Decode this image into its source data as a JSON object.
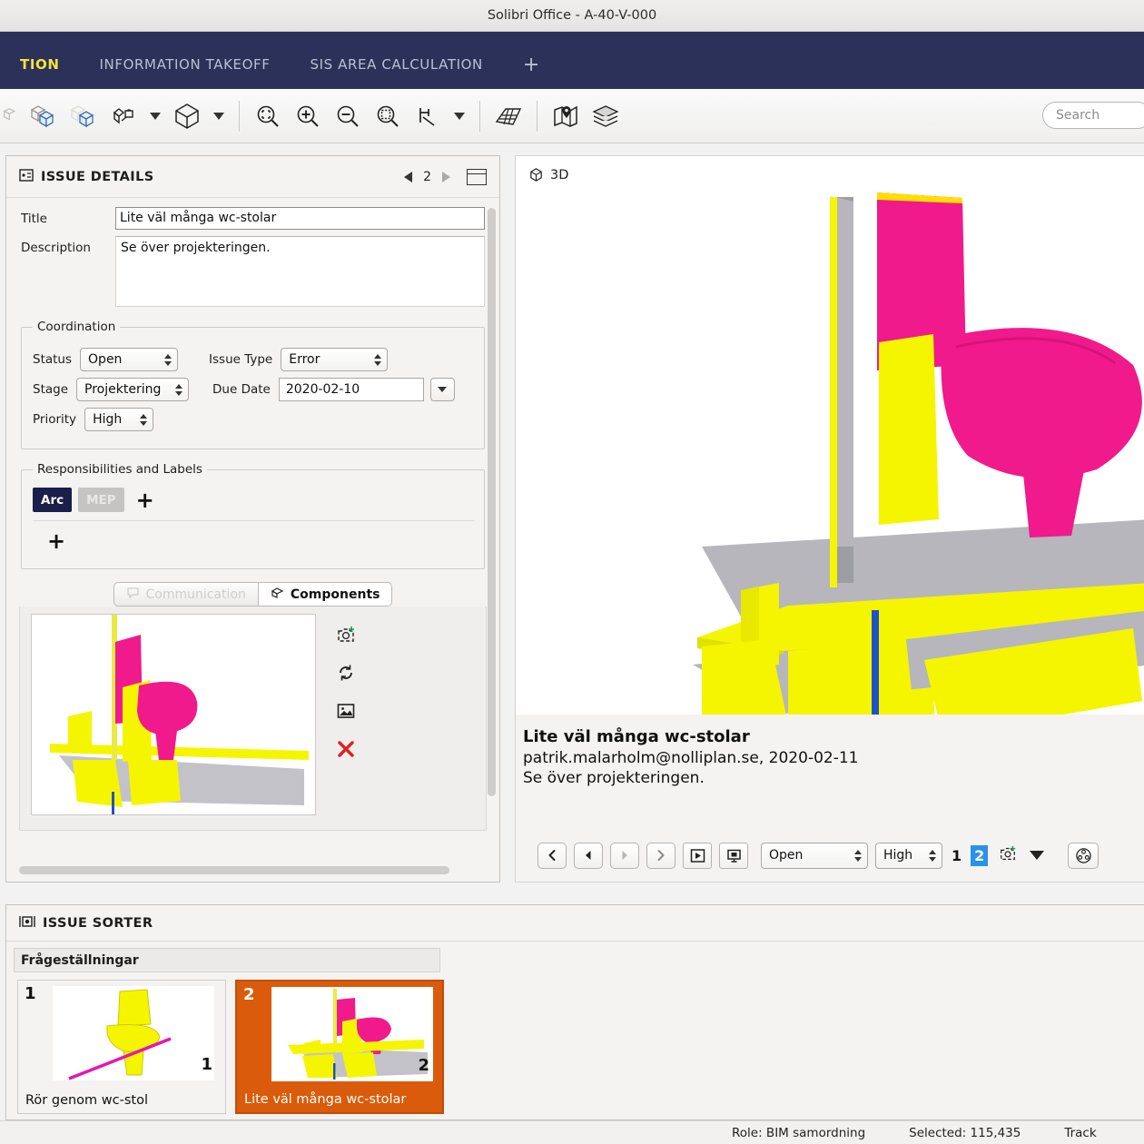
{
  "window": {
    "title": "Solibri Office - A-40-V-000"
  },
  "tabs": {
    "items": [
      {
        "label": "TION",
        "active": true
      },
      {
        "label": "INFORMATION TAKEOFF",
        "active": false
      },
      {
        "label": "SIS AREA CALCULATION",
        "active": false
      }
    ],
    "add_label": "+"
  },
  "toolbar": {
    "icons": [
      "model-tree-icon",
      "selection-basket-icon",
      "component-lock-icon",
      "view-cube-icon",
      "zoom-fit-icon",
      "zoom-in-icon",
      "zoom-out-icon",
      "zoom-area-icon",
      "section-icon",
      "grid-icon",
      "map-icon",
      "layers-icon"
    ],
    "search_placeholder": "Search",
    "search_value": ""
  },
  "issue_details": {
    "panel_title": "ISSUE DETAILS",
    "page_number": "2",
    "title_label": "Title",
    "title_value": "Lite väl många wc-stolar",
    "description_label": "Description",
    "description_value": "Se över projekteringen.",
    "coordination": {
      "legend": "Coordination",
      "status_label": "Status",
      "status_value": "Open",
      "issue_type_label": "Issue Type",
      "issue_type_value": "Error",
      "stage_label": "Stage",
      "stage_value": "Projektering",
      "due_date_label": "Due Date",
      "due_date_value": "2020-02-10",
      "priority_label": "Priority",
      "priority_value": "High"
    },
    "responsibilities": {
      "legend": "Responsibilities and Labels",
      "chips": [
        {
          "label": "Arc",
          "state": "active"
        },
        {
          "label": "MEP",
          "state": "disabled"
        }
      ],
      "add_label": "+",
      "add_row_label": "+"
    },
    "tabs": [
      {
        "label": "Communication",
        "active": false
      },
      {
        "label": "Components",
        "active": true
      }
    ],
    "thumb_actions": [
      "add-snapshot-icon",
      "refresh-icon",
      "image-icon",
      "delete-icon"
    ]
  },
  "viewport": {
    "label": "3D",
    "info": {
      "title": "Lite väl många wc-stolar",
      "meta": "patrik.malarholm@nolliplan.se, 2020-02-11",
      "body": "Se över projekteringen."
    },
    "nav": {
      "buttons": [
        "first-issue-icon",
        "previous-issue-icon",
        "next-issue-icon",
        "last-issue-icon",
        "play-icon",
        "presentation-icon"
      ],
      "status_value": "Open",
      "priority_value": "High",
      "pages": [
        {
          "label": "1",
          "selected": false
        },
        {
          "label": "2",
          "selected": true
        }
      ],
      "add_slide_icon": "add-snapshot-icon",
      "dropdown_icon": "chevron-down-icon",
      "settings_icon": "component-grid-icon"
    }
  },
  "issue_sorter": {
    "panel_title": "ISSUE SORTER",
    "group_title": "Frågeställningar",
    "cards": [
      {
        "number": "1",
        "count": "1",
        "caption": "Rör genom wc-stol",
        "selected": false
      },
      {
        "number": "2",
        "count": "2",
        "caption": "Lite väl många wc-stolar",
        "selected": true
      }
    ]
  },
  "status_bar": {
    "role": "Role: BIM samordning",
    "selected": "Selected: 115,435",
    "tracking": "Track"
  },
  "colors": {
    "tabbar_bg": "#2b3158",
    "tab_active": "#f5e23f",
    "chip_active_bg": "#1b1f4b",
    "selection_blue": "#2a92e8",
    "card_selected_bg": "#da5b0b",
    "model_yellow": "#f5f500",
    "model_magenta": "#f01a8c",
    "model_grey": "#b6b6bc",
    "model_blue": "#1f52c4"
  }
}
